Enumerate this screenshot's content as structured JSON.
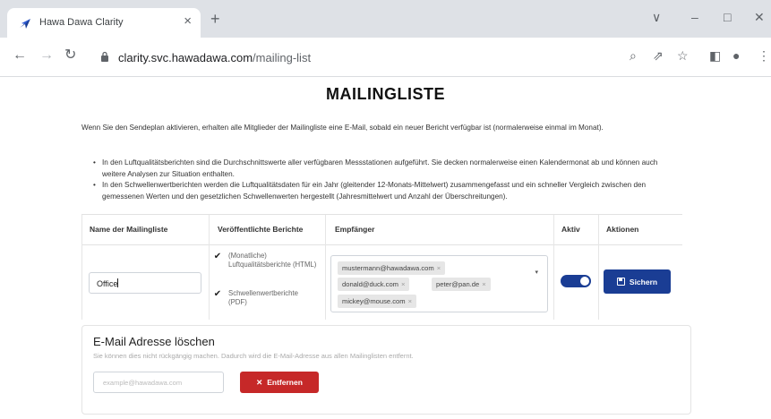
{
  "browser": {
    "tab_title": "Hawa Dawa Clarity",
    "tab_close": "×",
    "new_tab": "+",
    "url_host": "clarity.svc.hawadawa.com",
    "url_path": "/mailing-list",
    "window_controls": {
      "minimize": "–",
      "maximize": "□",
      "close": "✕",
      "chevron": "∨"
    },
    "nav": {
      "back": "←",
      "forward": "→",
      "reload": "↻"
    },
    "toolbar_icons": {
      "zoom": "⌕",
      "share": "⇗",
      "bookmark": "☆",
      "sidepanel": "◧",
      "profile": "●",
      "menu": "⋮"
    }
  },
  "page": {
    "title": "MAILINGLISTE",
    "intro": "Wenn Sie den Sendeplan aktivieren, erhalten alle Mitglieder der Mailingliste eine E-Mail, sobald ein neuer Bericht verfügbar ist (normalerweise einmal im Monat).",
    "bullets": [
      "In den Luftqualitätsberichten sind die Durchschnittswerte aller verfügbaren Messstationen aufgeführt. Sie decken normalerweise einen Kalendermonat ab und können auch weitere Analysen zur Situation enthalten.",
      "In den Schwellenwertberichten werden die Luftqualitätsdaten für ein Jahr (gleitender 12-Monats-Mittelwert) zusammengefasst und ein schneller Vergleich zwischen den gemessenen Werten und den gesetzlichen Schwellenwerten hergestellt (Jahresmittelwert und Anzahl der Überschreitungen)."
    ]
  },
  "table": {
    "headers": {
      "name": "Name der Mailingliste",
      "reports": "Veröffentlichte Berichte",
      "recipients": "Empfänger",
      "active": "Aktiv",
      "actions": "Aktionen"
    },
    "row": {
      "name_value": "Office",
      "report_monthly": "(Monatliche) Luftqualitätsberichte (HTML)",
      "report_threshold": "Schwellenwertberichte (PDF)",
      "checkbox_mark": "✔",
      "recipients": [
        "mustermann@hawadawa.com",
        "donald@duck.com",
        "peter@pan.de",
        "mickey@mouse.com"
      ],
      "chip_remove": "×",
      "dropdown_arrow": "▾",
      "active": true,
      "save_label": "Sichern"
    }
  },
  "delete_section": {
    "title": "E-Mail Adresse löschen",
    "description": "Sie können dies nicht rückgängig machen. Dadurch wird die E-Mail-Adresse aus allen Mailinglisten entfernt.",
    "email_placeholder": "example@hawadawa.com",
    "remove_icon": "✕",
    "remove_label": "Entfernen"
  },
  "colors": {
    "primary": "#1a3d94",
    "danger": "#c62828",
    "chrome": "#dee1e6"
  }
}
